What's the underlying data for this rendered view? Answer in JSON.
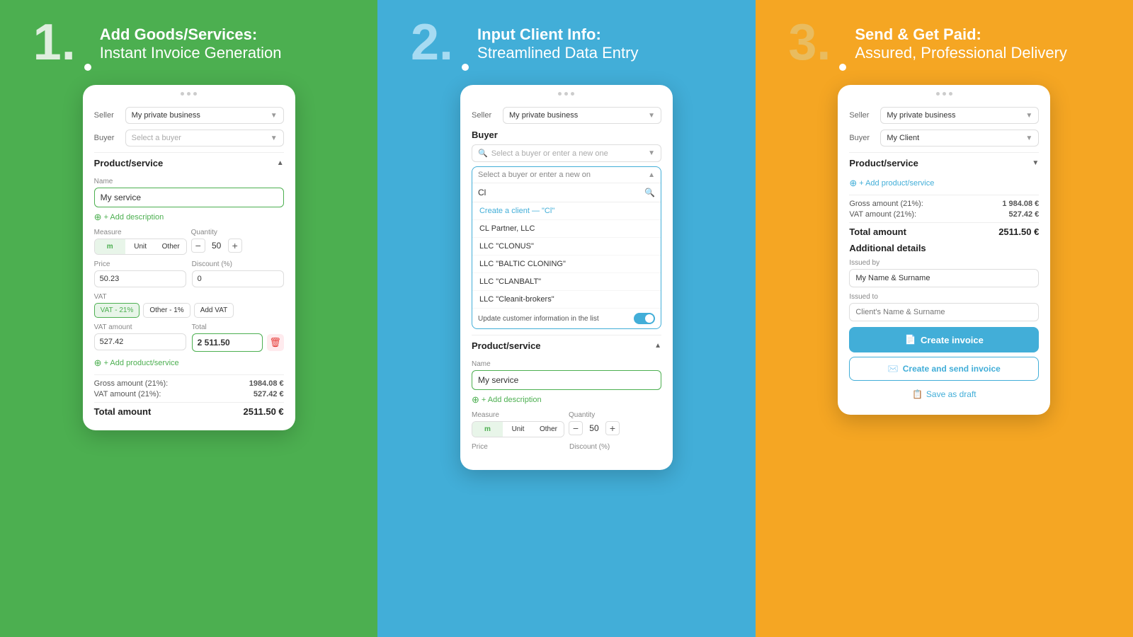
{
  "panel1": {
    "step_number": "1.",
    "step_dot": "•",
    "title_bold": "Add Goods/Services:",
    "title_normal": "Instant Invoice Generation",
    "seller_label": "Seller",
    "seller_value": "My private business",
    "buyer_label": "Buyer",
    "buyer_placeholder": "Select a buyer",
    "product_section": "Product/service",
    "name_label": "Name",
    "name_value": "My service",
    "add_description": "+ Add description",
    "measure_label": "Measure",
    "measure_m": "m",
    "measure_unit": "Unit",
    "measure_other": "Other",
    "quantity_label": "Quantity",
    "quantity_value": "50",
    "price_label": "Price",
    "price_value": "50.23",
    "discount_label": "Discount (%)",
    "discount_value": "0",
    "vat_label": "VAT",
    "vat_21": "VAT - 21%",
    "vat_other": "Other - 1%",
    "vat_add": "Add VAT",
    "vat_amount_label": "VAT amount",
    "vat_amount_value": "527.42",
    "total_label": "Total",
    "total_value": "2 511.50",
    "add_product": "+ Add product/service",
    "gross_label": "Gross amount (21%):",
    "gross_value": "1984.08 €",
    "vat_sum_label": "VAT amount (21%):",
    "vat_sum_value": "527.42 €",
    "total_amount_label": "Total amount",
    "total_amount_value": "2511.50 €"
  },
  "panel2": {
    "step_number": "2.",
    "title_bold": "Input Client Info:",
    "title_normal": "Streamlined Data Entry",
    "seller_label": "Seller",
    "seller_value": "My private business",
    "buyer_label": "Buyer",
    "buyer_search_placeholder": "Select a buyer or enter a new one",
    "dropdown_header": "Select a buyer or enter a new on",
    "search_typed": "Cl",
    "create_client": "Create a client — \"Cl\"",
    "client_1": "CL Partner, LLC",
    "client_2": "LLC \"CLONUS\"",
    "client_3": "LLC \"BALTIC CLONING\"",
    "client_4": "LLC \"CLANBALT\"",
    "client_5": "LLC \"Cleanit-brokers\"",
    "update_toggle_label": "Update customer information in the list",
    "product_section": "Product/service",
    "name_label": "Name",
    "name_value": "My service",
    "add_description": "+ Add description",
    "measure_label": "Measure",
    "measure_m": "m",
    "measure_unit": "Unit",
    "measure_other": "Other",
    "quantity_label": "Quantity",
    "quantity_value": "50",
    "price_label": "Price",
    "discount_label": "Discount (%)"
  },
  "panel3": {
    "step_number": "3.",
    "title_bold": "Send & Get Paid:",
    "title_normal": "Assured, Professional Delivery",
    "seller_label": "Seller",
    "seller_value": "My private business",
    "buyer_label": "Buyer",
    "buyer_value": "My Client",
    "product_section": "Product/service",
    "add_product": "+ Add product/service",
    "gross_label": "Gross amount (21%):",
    "gross_value": "1 984.08 €",
    "vat_label": "VAT amount (21%):",
    "vat_value": "527.42 €",
    "total_label": "Total amount",
    "total_value": "2511.50 €",
    "additional_title": "Additional details",
    "issued_by_label": "Issued by",
    "issued_by_value": "My Name & Surname",
    "issued_to_label": "Issued to",
    "issued_to_placeholder": "Client's Name & Surname",
    "btn_create": "Create invoice",
    "btn_create_send": "Create and send invoice",
    "btn_draft": "Save as draft"
  }
}
